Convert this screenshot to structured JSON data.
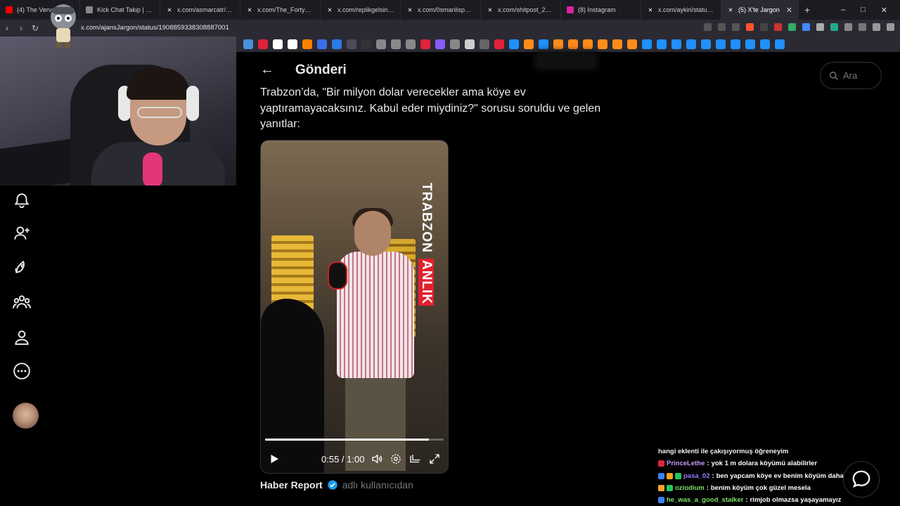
{
  "browser": {
    "tabs": [
      {
        "title": "(4) The Verve",
        "fav": "youtube",
        "color": "#ff0000"
      },
      {
        "title": "Kick Chat Takip | Wich",
        "fav": "globe",
        "color": "#888888"
      },
      {
        "title": "x.com/asmarcatr/statu",
        "fav": "x",
        "color": "#ffffff"
      },
      {
        "title": "x.com/The_Forty_Four",
        "fav": "x",
        "color": "#ffffff"
      },
      {
        "title": "x.com/replikgelsin/stat",
        "fav": "x",
        "color": "#ffffff"
      },
      {
        "title": "x.com/0smanlisporFK/",
        "fav": "x",
        "color": "#ffffff"
      },
      {
        "title": "x.com/shitpost_2077/st",
        "fav": "x",
        "color": "#ffffff"
      },
      {
        "title": "(8) Instagram",
        "fav": "instagram",
        "color": "#d6249f"
      },
      {
        "title": "x.com/aykiri/status/20",
        "fav": "x",
        "color": "#ffffff"
      },
      {
        "title": "(5) X'te Jargon",
        "fav": "x",
        "color": "#ffffff",
        "active": true
      }
    ],
    "new_tab": "+",
    "url": "x.com/ajansJargon/status/1908859338308887001"
  },
  "sidebar": {
    "icons": [
      "bell-icon",
      "add-user-icon",
      "rocket-icon",
      "communities-icon",
      "profile-icon",
      "more-icon"
    ]
  },
  "header": {
    "back": "←",
    "title": "Gönderi"
  },
  "search": {
    "placeholder": "Ara"
  },
  "tweet": {
    "text": "Trabzon’da, \"Bir milyon dolar verecekler ama köye ev yaptıramayacaksınız. Kabul eder miydiniz?\" sorusu soruldu ve gelen yanıtlar:"
  },
  "video": {
    "brand_white": "TRABZON",
    "brand_red": "ANLIK",
    "time": "0:55 / 1:00",
    "progress": 0.917
  },
  "source": {
    "name": "Haber Report",
    "suffix": "adlı kullanıcıdan"
  },
  "chat": {
    "first": "hangi eklenti ile çakışıyormuş öğreneyim",
    "lines": [
      {
        "user": "PrinceLethe",
        "color": "#c79bff",
        "badges": [
          "#e0233a"
        ],
        "text": "yok 1 m dolara köyümü alabilirler"
      },
      {
        "user": "pasa_02",
        "color": "#9b7bff",
        "badges": [
          "#3b82f6",
          "#f5a623",
          "#22c55e"
        ],
        "text": "ben yapcam köye ev benim köyüm daha güzel"
      },
      {
        "user": "oziodium",
        "color": "#7ee06a",
        "badges": [
          "#f5a623",
          "#22c55e"
        ],
        "text": "benim köyüm çok güzel mesela"
      },
      {
        "user": "he_was_a_good_stalker",
        "color": "#7ee06a",
        "badges": [
          "#3b82f6"
        ],
        "text": "rimjob olmazsa yaşayamayız"
      }
    ]
  }
}
